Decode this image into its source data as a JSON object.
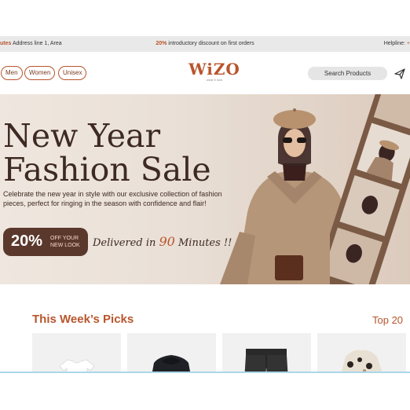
{
  "announcement": {
    "left_highlight": "utes",
    "left_text": " Address line 1, Area",
    "center_highlight": "20%",
    "center_text": " introductory discount on first orders",
    "right_text": "Helpline: ",
    "right_highlight": "+"
  },
  "header": {
    "nav": [
      "Men",
      "Women",
      "Unisex"
    ],
    "logo_text": "WiZO",
    "logo_tagline": "wear it now",
    "search_label": "Search Products"
  },
  "hero": {
    "title_line1": "New Year",
    "title_line2": "Fashion Sale",
    "description": "Celebrate the new year in style with our exclusive collection of fashion pieces, perfect for ringing in the season with confidence and flair!",
    "promo_percent": "20%",
    "promo_line1": "OFF YOUR",
    "promo_line2": "NEW LOOK",
    "delivered_prefix": "Delivered in ",
    "delivered_number": "90",
    "delivered_suffix": " Minutes !!"
  },
  "section": {
    "title": "This Week’s Picks",
    "right_label": "Top 20"
  },
  "products": [
    {
      "icon": "white-tshirt-icon"
    },
    {
      "icon": "black-hoodie-icon"
    },
    {
      "icon": "black-pants-icon"
    },
    {
      "icon": "printed-blouse-icon"
    }
  ],
  "colors": {
    "accent": "#b8552c",
    "dark_brown": "#5b382c",
    "hero_bg": "#e9dfd6"
  }
}
